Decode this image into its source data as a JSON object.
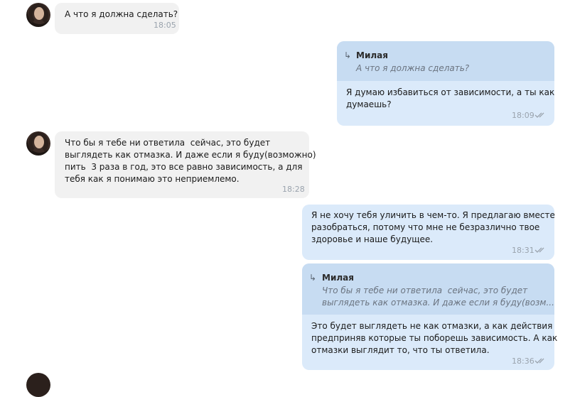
{
  "messages": [
    {
      "text": "А что я должна сделать?",
      "time": "18:05"
    },
    {
      "quote_name": "Милая",
      "quote_text": "А что я должна сделать?",
      "text_l1": "Я думаю избавиться от зависимости, а ты как",
      "text_l2": "думаешь?",
      "time": "18:09"
    },
    {
      "text_l1": "Что бы я тебе ни ответила  сейчас, это будет",
      "text_l2": "выглядеть как отмазка. И даже если я буду(возможно)",
      "text_l3": "пить  3 раза в год, это все равно зависимость, а для",
      "text_l4": "тебя как я понимаю это неприемлемо.",
      "time": "18:28"
    },
    {
      "text_l1": "Я не хочу тебя уличить в чем-то. Я предлагаю вместе",
      "text_l2": "разобраться, потому что мне не безразлично твое",
      "text_l3": "здоровье и наше будущее.",
      "time": "18:31"
    },
    {
      "quote_name": "Милая",
      "quote_l1": "Что бы я тебе ни ответила  сейчас, это будет",
      "quote_l2": "выглядеть как отмазка. И даже если я буду(возм...",
      "text_l1": "Это будет выглядеть не как отмазки, а как действия",
      "text_l2": "предприняв которые ты поборешь зависимость. А как",
      "text_l3": "отмазки выглядит то, что ты ответила.",
      "time": "18:36"
    }
  ],
  "icons": {
    "reply": "↳"
  },
  "colors": {
    "incoming": "#f1f1f1",
    "outgoing": "#dbeafa",
    "quote": "#c7dcf2"
  }
}
